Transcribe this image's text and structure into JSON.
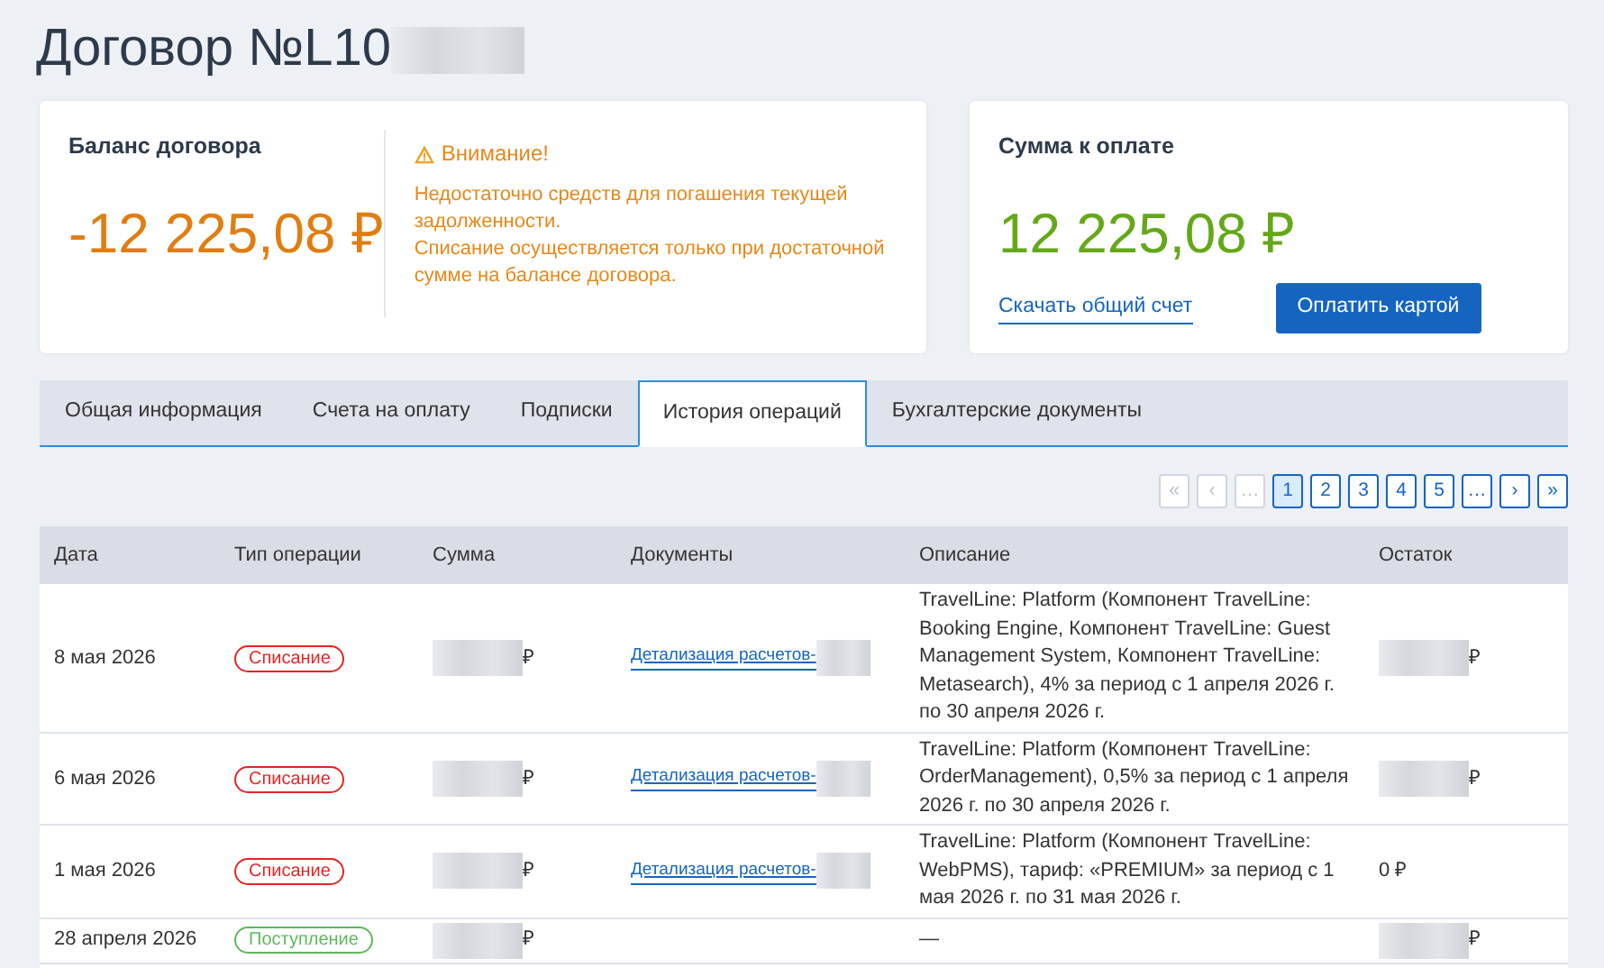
{
  "page_title": {
    "text": "Договор №L10",
    "suffix_hidden": true
  },
  "balance_card": {
    "heading": "Баланс договора",
    "amount": "-12 225,08 ₽",
    "warning_title": "Внимание!",
    "warning_text": [
      "Недостаточно средств для погашения текущей задолженности.",
      "Списание осуществляется только при достаточной сумме на балансе договора."
    ]
  },
  "payment_card": {
    "heading": "Сумма к оплате",
    "amount": "12 225,08 ₽",
    "download_link": "Скачать общий счет",
    "pay_button": "Оплатить картой"
  },
  "tabs": [
    {
      "label": "Общая информация",
      "selected": false
    },
    {
      "label": "Счета на оплату",
      "selected": false
    },
    {
      "label": "Подписки",
      "selected": false
    },
    {
      "label": "История операций",
      "selected": true
    },
    {
      "label": "Бухгалтерские документы",
      "selected": false
    }
  ],
  "pagination": [
    {
      "label": "«",
      "disabled": true,
      "selected": false
    },
    {
      "label": "‹",
      "disabled": true,
      "selected": false
    },
    {
      "label": "…",
      "disabled": true,
      "selected": false
    },
    {
      "label": "1",
      "disabled": false,
      "selected": true
    },
    {
      "label": "2",
      "disabled": false,
      "selected": false
    },
    {
      "label": "3",
      "disabled": false,
      "selected": false
    },
    {
      "label": "4",
      "disabled": false,
      "selected": false
    },
    {
      "label": "5",
      "disabled": false,
      "selected": false
    },
    {
      "label": "…",
      "disabled": false,
      "selected": false
    },
    {
      "label": "›",
      "disabled": false,
      "selected": false
    },
    {
      "label": "»",
      "disabled": false,
      "selected": false
    }
  ],
  "table": {
    "columns": [
      "Дата",
      "Тип операции",
      "Сумма",
      "Документы",
      "Описание",
      "Остаток"
    ],
    "rows": [
      {
        "date": "8 мая 2026",
        "type": {
          "label": "Списание",
          "kind": "debit"
        },
        "sum": {
          "text": "₽",
          "hidden": true
        },
        "document": {
          "text": "Детализация расчетов-",
          "hidden": true
        },
        "description": "TravelLine: Platform (Компонент TravelLine: Booking Engine, Компонент TravelLine: Guest Management System, Компонент TravelLine: Metasearch), 4% за период с 1 апреля 2026 г. по 30 апреля 2026 г.",
        "balance": {
          "text": "₽",
          "hidden": true
        }
      },
      {
        "date": "6 мая 2026",
        "type": {
          "label": "Списание",
          "kind": "debit"
        },
        "sum": {
          "text": "₽",
          "hidden": true
        },
        "document": {
          "text": "Детализация расчетов-",
          "hidden": true
        },
        "description": "TravelLine: Platform (Компонент TravelLine: OrderManagement), 0,5% за период с 1 апреля 2026 г. по 30 апреля 2026 г.",
        "balance": {
          "text": "₽",
          "hidden": true
        }
      },
      {
        "date": "1 мая 2026",
        "type": {
          "label": "Списание",
          "kind": "debit"
        },
        "sum": {
          "text": "₽",
          "hidden": true
        },
        "document": {
          "text": "Детализация расчетов-",
          "hidden": true
        },
        "description": "TravelLine: Platform (Компонент TravelLine: WebPMS), тариф: «PREMIUM» за период с 1 мая 2026 г. по 31 мая 2026 г.",
        "balance": {
          "text": "0 ₽",
          "hidden": false
        }
      },
      {
        "date": "28 апреля 2026",
        "type": {
          "label": "Поступление",
          "kind": "credit"
        },
        "sum": {
          "text": "₽",
          "hidden": true
        },
        "description": "—",
        "balance": {
          "text": "₽",
          "hidden": true
        }
      }
    ]
  }
}
